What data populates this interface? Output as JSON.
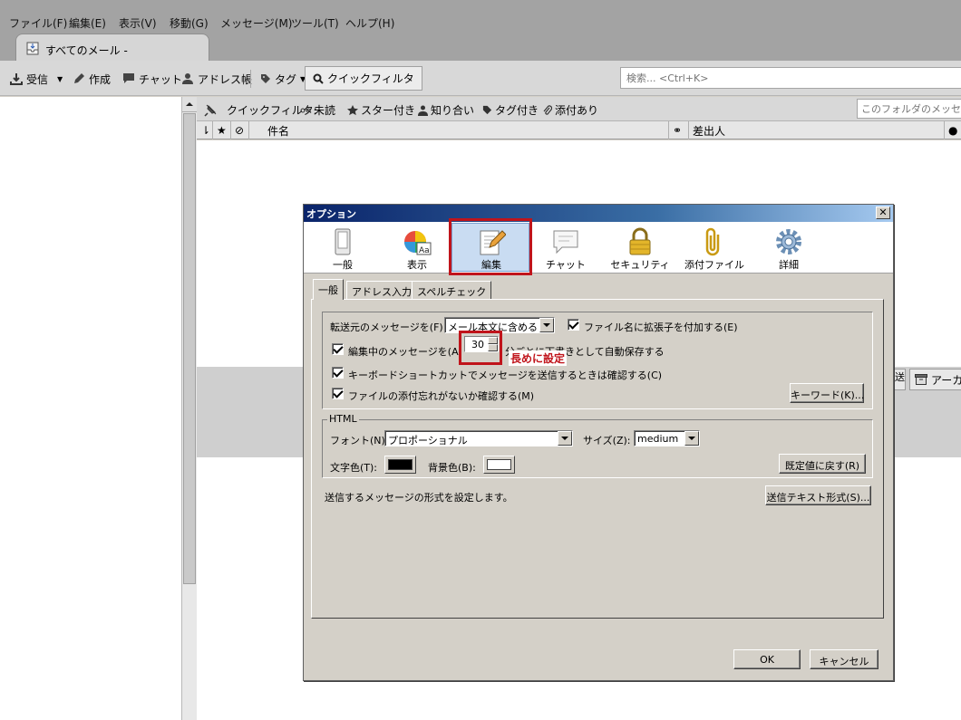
{
  "menubar": {
    "items": [
      "ファイル(F)",
      "編集(E)",
      "表示(V)",
      "移動(G)",
      "メッセージ(M)",
      "ツール(T)",
      "ヘルプ(H)"
    ]
  },
  "tab": {
    "label": "すべてのメール -"
  },
  "toolbar": {
    "get_mail": "受信",
    "write": "作成",
    "chat": "チャット",
    "address_book": "アドレス帳",
    "tag": "タグ",
    "quick_filter": "クイックフィルタ",
    "search_placeholder": "検索... <Ctrl+K>"
  },
  "quickfilter": {
    "label": "クイックフィルタ:",
    "unread": "未読",
    "starred": "スター付き",
    "contacts": "知り合い",
    "tagged": "タグ付き",
    "attachment": "添付あり",
    "folder_search_placeholder": "このフォルダのメッセージ"
  },
  "columns": {
    "subject": "件名",
    "sender": "差出人"
  },
  "message_toolbar": {
    "prev_partial": "送",
    "archive": "アーカ"
  },
  "dialog": {
    "title": "オプション",
    "close": "✕",
    "panes": [
      {
        "label": "一般",
        "icon": "general-icon"
      },
      {
        "label": "表示",
        "icon": "display-icon"
      },
      {
        "label": "編集",
        "icon": "composition-icon"
      },
      {
        "label": "チャット",
        "icon": "chat-icon"
      },
      {
        "label": "セキュリティ",
        "icon": "security-icon"
      },
      {
        "label": "添付ファイル",
        "icon": "attachments-icon"
      },
      {
        "label": "詳細",
        "icon": "advanced-icon"
      }
    ],
    "tabs": [
      "一般",
      "アドレス入力",
      "スペルチェック"
    ],
    "general": {
      "forward_label": "転送元のメッセージを(F):",
      "forward_value": "メール本文に含める",
      "extension_label": "ファイル名に拡張子を付加する(E)",
      "autosave_label": "編集中のメッセージを(A)",
      "autosave_value": "30",
      "autosave_suffix": "分ごとに下書きとして自動保存する",
      "shortcut_label": "キーボードショートカットでメッセージを送信するときは確認する(C)",
      "attach_check_label": "ファイルの添付忘れがないか確認する(M)",
      "keywords_button": "キーワード(K)..."
    },
    "html": {
      "group_label": "HTML",
      "font_label": "フォント(N):",
      "font_value": "プロポーショナル",
      "size_label": "サイズ(Z):",
      "size_value": "medium",
      "text_color_label": "文字色(T):",
      "bg_color_label": "背景色(B):",
      "text_color": "#000000",
      "bg_color": "#ffffff",
      "restore_button": "既定値に戻す(R)"
    },
    "send_format_text": "送信するメッセージの形式を設定します。",
    "send_format_button": "送信テキスト形式(S)...",
    "ok": "OK",
    "cancel": "キャンセル"
  },
  "annotation": {
    "note": "長めに設定",
    "color": "#c0141b"
  }
}
